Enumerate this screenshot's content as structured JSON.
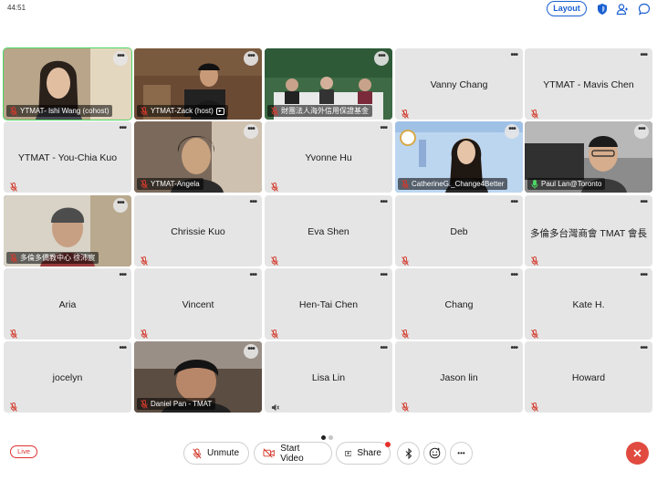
{
  "status": {
    "time": "44:51"
  },
  "header": {
    "layout_label": "Layout"
  },
  "participants": [
    {
      "name": "YTMAT- Ishi Wang (cohost)",
      "video": true,
      "active": true
    },
    {
      "name": "YTMAT-Zack (host)",
      "video": true,
      "cc": true
    },
    {
      "name": "財團法人海外信用保證基金",
      "video": true
    },
    {
      "name": "Vanny Chang",
      "video": false
    },
    {
      "name": "YTMAT - Mavis Chen",
      "video": false
    },
    {
      "name": "YTMAT - You-Chia Kuo",
      "video": false
    },
    {
      "name": "YTMAT-Angela",
      "video": true
    },
    {
      "name": "Yvonne Hu",
      "video": false
    },
    {
      "name": "CatherineG._Change4Better",
      "video": true
    },
    {
      "name": "Paul Lan@Toronto",
      "video": true,
      "mic_on": true
    },
    {
      "name": "多倫多僑教中心 徐沛宸",
      "video": true
    },
    {
      "name": "Chrissie Kuo",
      "video": false
    },
    {
      "name": "Eva Shen",
      "video": false
    },
    {
      "name": "Deb",
      "video": false
    },
    {
      "name": "多倫多台灣商會 TMAT 會長",
      "video": false
    },
    {
      "name": "Aria",
      "video": false
    },
    {
      "name": "Vincent",
      "video": false
    },
    {
      "name": "Hen-Tai Chen",
      "video": false
    },
    {
      "name": "Chang",
      "video": false
    },
    {
      "name": "Kate H.",
      "video": false
    },
    {
      "name": "jocelyn",
      "video": false
    },
    {
      "name": "Daniel Pan - TMAT",
      "video": true
    },
    {
      "name": "Lisa Lin",
      "video": false,
      "speaker": true
    },
    {
      "name": "Jason lin",
      "video": false
    },
    {
      "name": "Howard",
      "video": false
    }
  ],
  "more_label": "•••",
  "toolbar": {
    "live_label": "Live",
    "unmute_label": "Unmute",
    "start_video_label": "Start Video",
    "share_label": "Share",
    "more_label": "•••"
  },
  "colors": {
    "accent": "#1a5fd1",
    "muted": "#d33a2c",
    "active": "#4cd964",
    "end": "#e04a3f"
  }
}
